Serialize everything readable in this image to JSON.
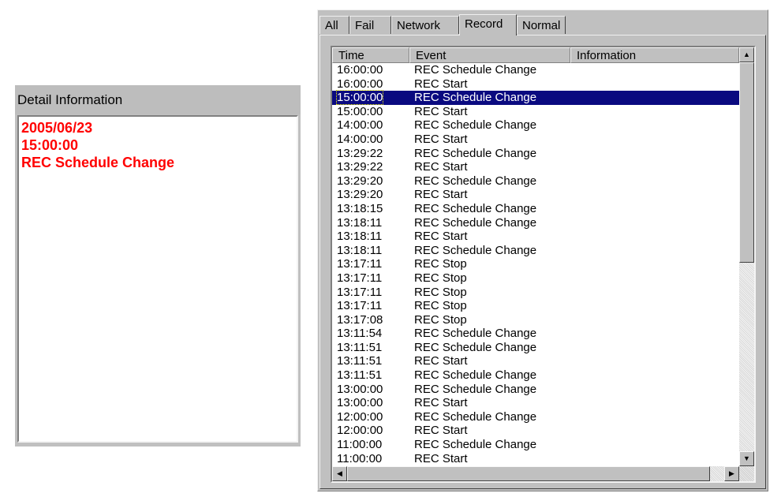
{
  "detail": {
    "title": "Detail Information",
    "date": "2005/06/23",
    "time": "15:00:00",
    "event": "REC Schedule Change",
    "text_color": "#ff0000"
  },
  "tabs": [
    {
      "label": "All",
      "active": false
    },
    {
      "label": "Fail",
      "active": false
    },
    {
      "label": "Network",
      "active": false
    },
    {
      "label": "Record",
      "active": true
    },
    {
      "label": "Normal",
      "active": false
    }
  ],
  "log": {
    "columns": [
      "Time",
      "Event",
      "Information"
    ],
    "selected_index": 2,
    "selection_color": "#0a0a80",
    "rows": [
      {
        "time": "16:00:00",
        "event": "REC Schedule Change"
      },
      {
        "time": "16:00:00",
        "event": "REC Start"
      },
      {
        "time": "15:00:00",
        "event": "REC Schedule Change"
      },
      {
        "time": "15:00:00",
        "event": "REC Start"
      },
      {
        "time": "14:00:00",
        "event": "REC Schedule Change"
      },
      {
        "time": "14:00:00",
        "event": "REC Start"
      },
      {
        "time": "13:29:22",
        "event": "REC Schedule Change"
      },
      {
        "time": "13:29:22",
        "event": "REC Start"
      },
      {
        "time": "13:29:20",
        "event": "REC Schedule Change"
      },
      {
        "time": "13:29:20",
        "event": "REC Start"
      },
      {
        "time": "13:18:15",
        "event": "REC Schedule Change"
      },
      {
        "time": "13:18:11",
        "event": "REC Schedule Change"
      },
      {
        "time": "13:18:11",
        "event": "REC Start"
      },
      {
        "time": "13:18:11",
        "event": "REC Schedule Change"
      },
      {
        "time": "13:17:11",
        "event": "REC Stop"
      },
      {
        "time": "13:17:11",
        "event": "REC Stop"
      },
      {
        "time": "13:17:11",
        "event": "REC Stop"
      },
      {
        "time": "13:17:11",
        "event": "REC Stop"
      },
      {
        "time": "13:17:08",
        "event": "REC Stop"
      },
      {
        "time": "13:11:54",
        "event": "REC Schedule Change"
      },
      {
        "time": "13:11:51",
        "event": "REC Schedule Change"
      },
      {
        "time": "13:11:51",
        "event": "REC Start"
      },
      {
        "time": "13:11:51",
        "event": "REC Schedule Change"
      },
      {
        "time": "13:00:00",
        "event": "REC Schedule Change"
      },
      {
        "time": "13:00:00",
        "event": "REC Start"
      },
      {
        "time": "12:00:00",
        "event": "REC Schedule Change"
      },
      {
        "time": "12:00:00",
        "event": "REC Start"
      },
      {
        "time": "11:00:00",
        "event": "REC Schedule Change"
      },
      {
        "time": "11:00:00",
        "event": "REC Start"
      }
    ]
  },
  "icons": {
    "scroll_up": "▲",
    "scroll_down": "▼",
    "scroll_left": "◀",
    "scroll_right": "▶"
  }
}
